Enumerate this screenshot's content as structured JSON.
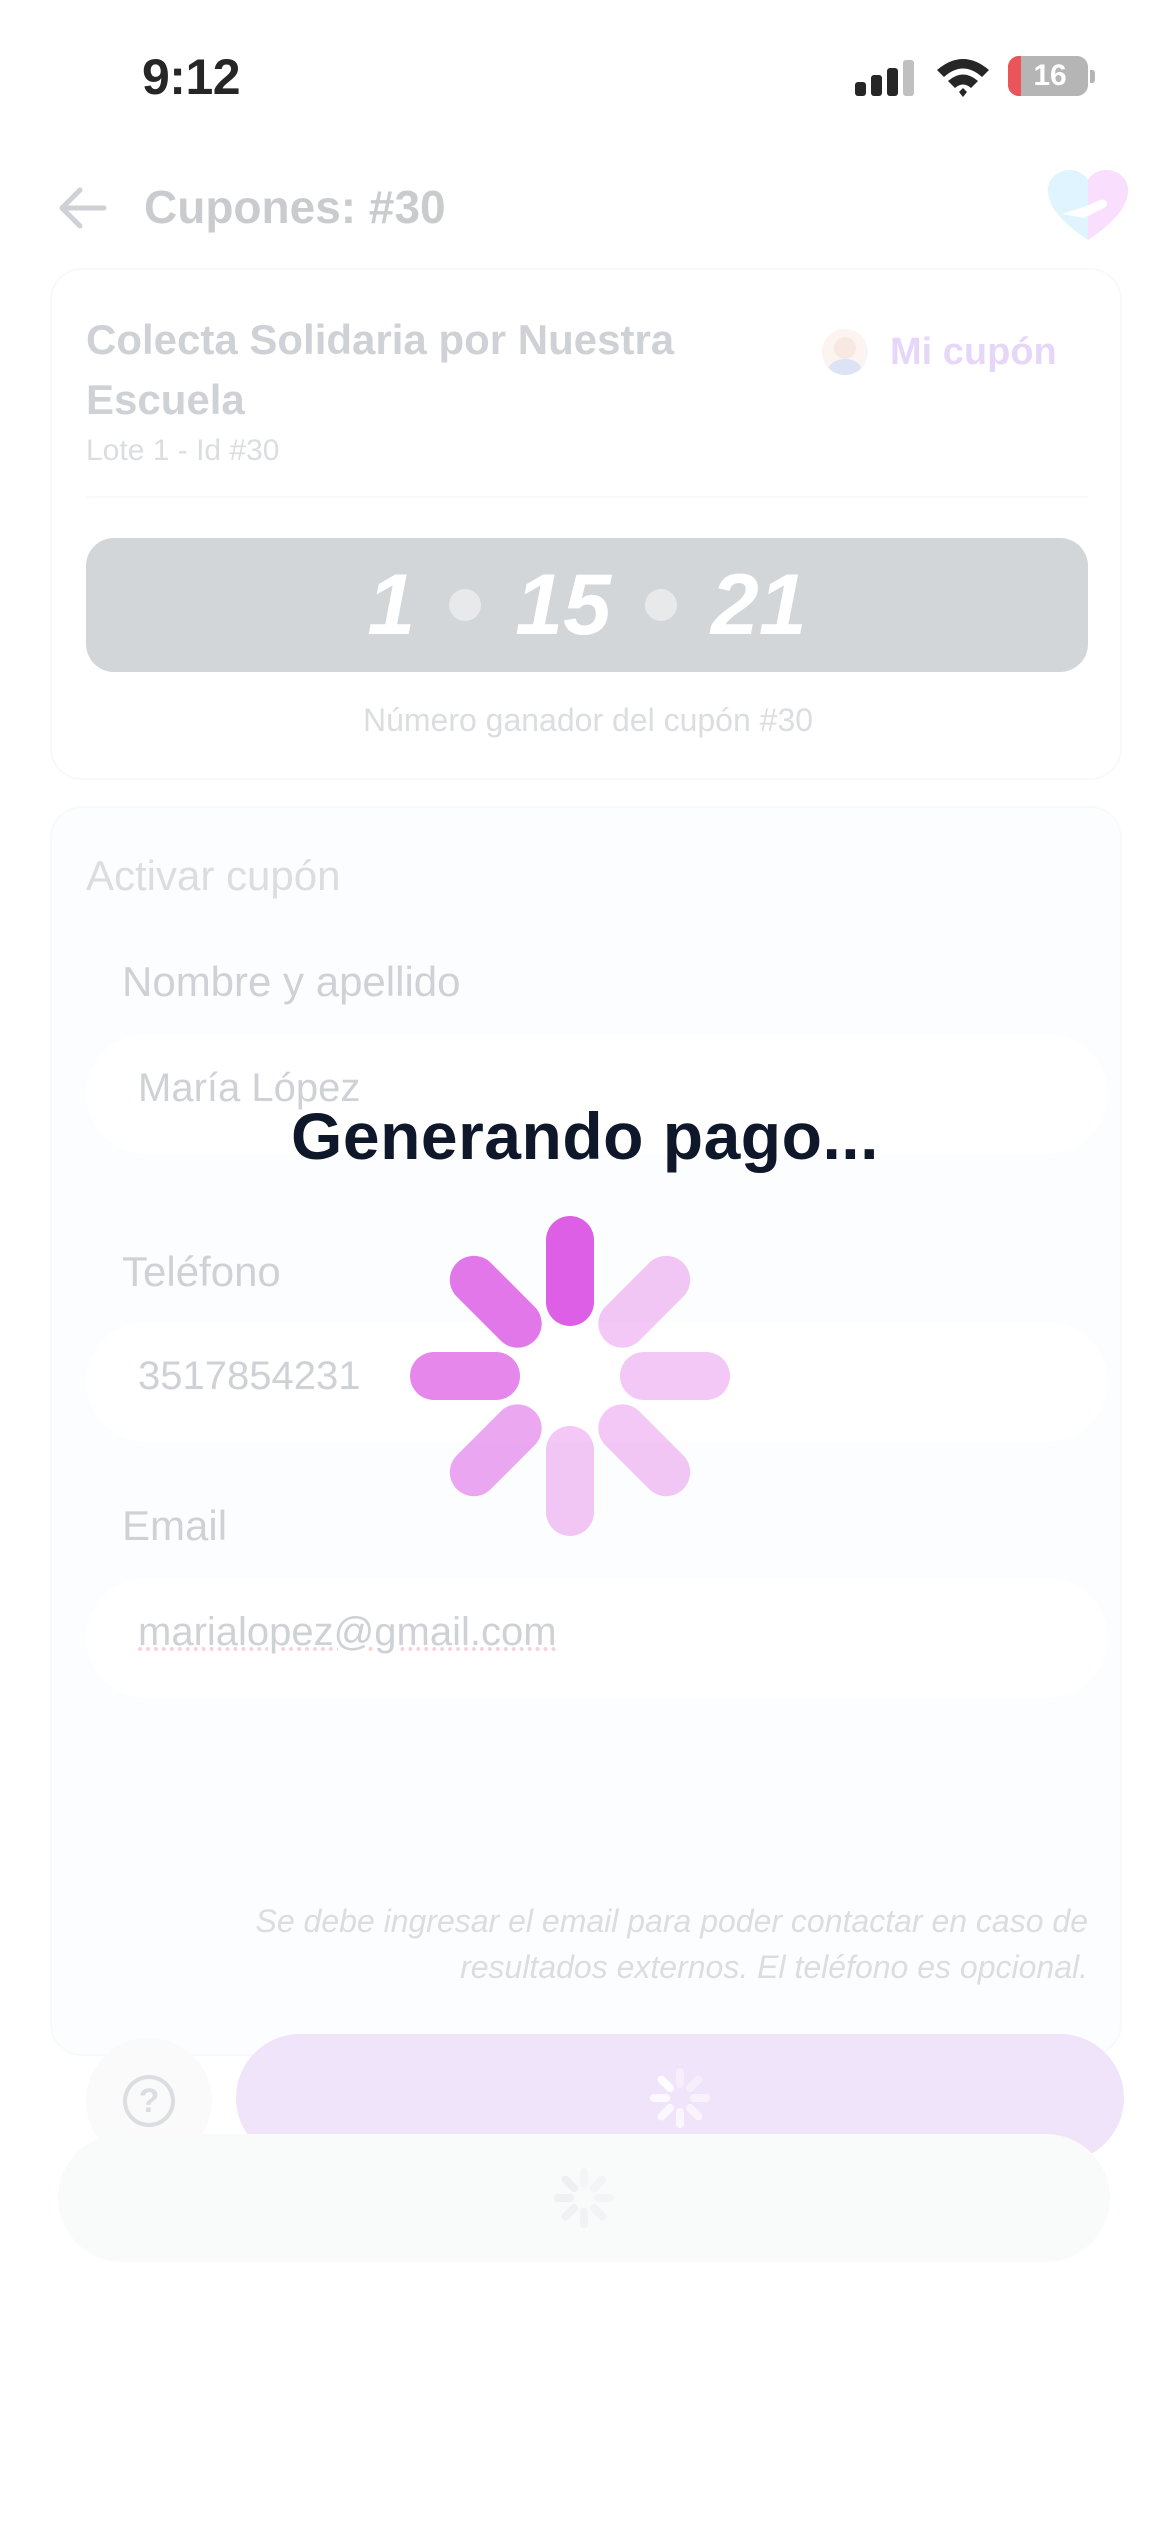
{
  "status_bar": {
    "time": "9:12",
    "battery": "16",
    "battery_fraction": 0.16
  },
  "header": {
    "title": "Cupones: #30",
    "back_icon": "arrow-left-icon",
    "logo_icon": "heart-hand-logo"
  },
  "coupon_card": {
    "campaign_title": "Colecta Solidaria por Nuestra Escuela",
    "subtitle": "Lote 1 - Id #30",
    "my_coupon_label": "Mi cupón",
    "numbers": [
      "1",
      "15",
      "21"
    ],
    "winner_label": "Número ganador del cupón #30"
  },
  "activation": {
    "section_title": "Activar cupón",
    "name_label": "Nombre y apellido",
    "name_value": "María López",
    "phone_label": "Teléfono",
    "phone_value": "3517854231",
    "email_label": "Email",
    "email_value": "marialopez@gmail.com",
    "hint": "Se debe ingresar el email para poder contactar en caso de resultados externos. El teléfono es opcional.",
    "help_icon": "question-circle-icon"
  },
  "overlay": {
    "loading_text": "Generando pago..."
  },
  "colors": {
    "accent": "#9b5de5",
    "spinner": "#dd5fe6",
    "text_dark": "#0f172a"
  }
}
